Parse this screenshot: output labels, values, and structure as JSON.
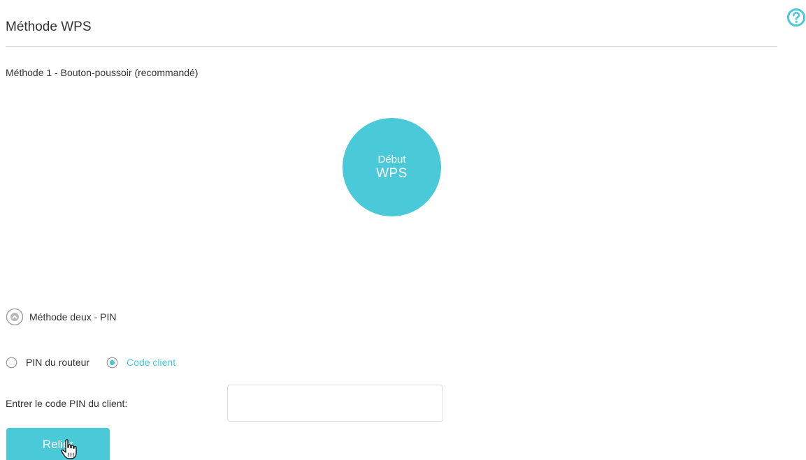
{
  "header": {
    "title": "Méthode WPS",
    "help_icon": "question-circle-icon"
  },
  "method1": {
    "label": "Méthode 1 - Bouton-poussoir (recommandé)",
    "wps_button_line1": "Début",
    "wps_button_line2": "WPS"
  },
  "method2": {
    "collapse_icon": "chevron-up-circle-icon",
    "label": "Méthode deux - PIN",
    "radio_options": [
      {
        "label": "PIN du routeur",
        "selected": false
      },
      {
        "label": "Code client",
        "selected": true
      }
    ],
    "pin_field_label": "Entrer le code PIN du client:",
    "pin_value": "",
    "connect_label": "Relier"
  },
  "colors": {
    "accent": "#4ac9d8",
    "text": "#333333",
    "divider": "#d6d6d6"
  },
  "cursor_icon": "hand-pointer-cursor-icon"
}
